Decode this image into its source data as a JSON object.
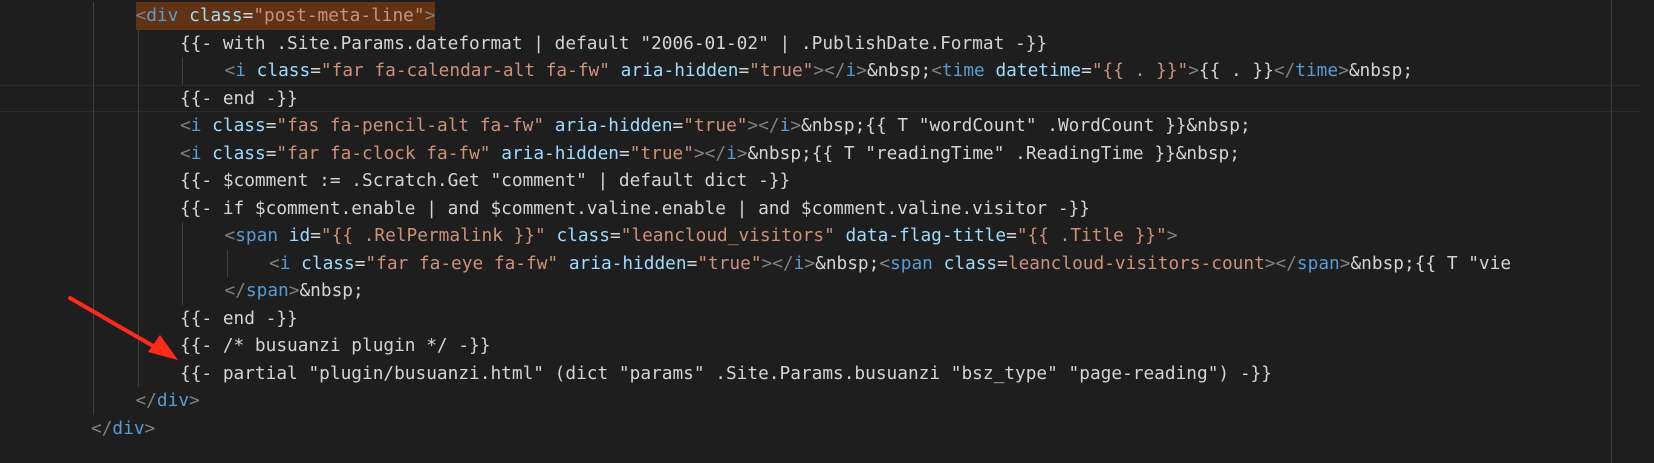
{
  "editor": {
    "lines": [
      {
        "indent": 3,
        "tokens": [
          [
            "br",
            "<"
          ],
          [
            "tag",
            "div"
          ],
          [
            "txt",
            " "
          ],
          [
            "attr",
            "class"
          ],
          [
            "txt",
            "="
          ],
          [
            "str",
            "\"post-meta-line\""
          ],
          [
            "br",
            ">"
          ]
        ],
        "highlight": true
      },
      {
        "indent": 4,
        "tokens": [
          [
            "txt",
            "{{- with .Site.Params.dateformat | default \"2006-01-02\" | .PublishDate.Format -}}"
          ]
        ]
      },
      {
        "indent": 5,
        "tokens": [
          [
            "br",
            "<"
          ],
          [
            "tag",
            "i"
          ],
          [
            "txt",
            " "
          ],
          [
            "attr",
            "class"
          ],
          [
            "txt",
            "="
          ],
          [
            "str",
            "\"far fa-calendar-alt fa-fw\""
          ],
          [
            "txt",
            " "
          ],
          [
            "attr",
            "aria-hidden"
          ],
          [
            "txt",
            "="
          ],
          [
            "str",
            "\"true\""
          ],
          [
            "br",
            "></"
          ],
          [
            "tag",
            "i"
          ],
          [
            "br",
            ">"
          ],
          [
            "txt",
            "&nbsp;"
          ],
          [
            "br",
            "<"
          ],
          [
            "tag",
            "time"
          ],
          [
            "txt",
            " "
          ],
          [
            "attr",
            "datetime"
          ],
          [
            "txt",
            "="
          ],
          [
            "str",
            "\"{{ . }}\""
          ],
          [
            "br",
            ">"
          ],
          [
            "txt",
            "{{ . }}"
          ],
          [
            "br",
            "</"
          ],
          [
            "tag",
            "time"
          ],
          [
            "br",
            ">"
          ],
          [
            "txt",
            "&nbsp;"
          ]
        ]
      },
      {
        "indent": 4,
        "tokens": [
          [
            "txt",
            "{{- end -}}"
          ]
        ],
        "current": true
      },
      {
        "indent": 4,
        "tokens": [
          [
            "br",
            "<"
          ],
          [
            "tag",
            "i"
          ],
          [
            "txt",
            " "
          ],
          [
            "attr",
            "class"
          ],
          [
            "txt",
            "="
          ],
          [
            "str",
            "\"fas fa-pencil-alt fa-fw\""
          ],
          [
            "txt",
            " "
          ],
          [
            "attr",
            "aria-hidden"
          ],
          [
            "txt",
            "="
          ],
          [
            "str",
            "\"true\""
          ],
          [
            "br",
            "></"
          ],
          [
            "tag",
            "i"
          ],
          [
            "br",
            ">"
          ],
          [
            "txt",
            "&nbsp;{{ T \"wordCount\" .WordCount }}&nbsp;"
          ]
        ]
      },
      {
        "indent": 4,
        "tokens": [
          [
            "br",
            "<"
          ],
          [
            "tag",
            "i"
          ],
          [
            "txt",
            " "
          ],
          [
            "attr",
            "class"
          ],
          [
            "txt",
            "="
          ],
          [
            "str",
            "\"far fa-clock fa-fw\""
          ],
          [
            "txt",
            " "
          ],
          [
            "attr",
            "aria-hidden"
          ],
          [
            "txt",
            "="
          ],
          [
            "str",
            "\"true\""
          ],
          [
            "br",
            "></"
          ],
          [
            "tag",
            "i"
          ],
          [
            "br",
            ">"
          ],
          [
            "txt",
            "&nbsp;{{ T \"readingTime\" .ReadingTime }}&nbsp;"
          ]
        ]
      },
      {
        "indent": 4,
        "tokens": [
          [
            "txt",
            "{{- $comment := .Scratch.Get \"comment\" | default dict -}}"
          ]
        ]
      },
      {
        "indent": 4,
        "tokens": [
          [
            "txt",
            "{{- if $comment.enable | and $comment.valine.enable | and $comment.valine.visitor -}}"
          ]
        ]
      },
      {
        "indent": 5,
        "tokens": [
          [
            "br",
            "<"
          ],
          [
            "tag",
            "span"
          ],
          [
            "txt",
            " "
          ],
          [
            "attr",
            "id"
          ],
          [
            "txt",
            "="
          ],
          [
            "str",
            "\"{{ .RelPermalink }}\""
          ],
          [
            "txt",
            " "
          ],
          [
            "attr",
            "class"
          ],
          [
            "txt",
            "="
          ],
          [
            "str",
            "\"leancloud_visitors\""
          ],
          [
            "txt",
            " "
          ],
          [
            "attr",
            "data-flag-title"
          ],
          [
            "txt",
            "="
          ],
          [
            "str",
            "\"{{ .Title }}\""
          ],
          [
            "br",
            ">"
          ]
        ]
      },
      {
        "indent": 6,
        "tokens": [
          [
            "br",
            "<"
          ],
          [
            "tag",
            "i"
          ],
          [
            "txt",
            " "
          ],
          [
            "attr",
            "class"
          ],
          [
            "txt",
            "="
          ],
          [
            "str",
            "\"far fa-eye fa-fw\""
          ],
          [
            "txt",
            " "
          ],
          [
            "attr",
            "aria-hidden"
          ],
          [
            "txt",
            "="
          ],
          [
            "str",
            "\"true\""
          ],
          [
            "br",
            "></"
          ],
          [
            "tag",
            "i"
          ],
          [
            "br",
            ">"
          ],
          [
            "txt",
            "&nbsp;"
          ],
          [
            "br",
            "<"
          ],
          [
            "tag",
            "span"
          ],
          [
            "txt",
            " "
          ],
          [
            "attr",
            "class"
          ],
          [
            "txt",
            "="
          ],
          [
            "str",
            "leancloud-visitors-count"
          ],
          [
            "br",
            "></"
          ],
          [
            "tag",
            "span"
          ],
          [
            "br",
            ">"
          ],
          [
            "txt",
            "&nbsp;{{ T \"vie"
          ]
        ]
      },
      {
        "indent": 5,
        "tokens": [
          [
            "br",
            "</"
          ],
          [
            "tag",
            "span"
          ],
          [
            "br",
            ">"
          ],
          [
            "txt",
            "&nbsp;"
          ]
        ]
      },
      {
        "indent": 4,
        "tokens": [
          [
            "txt",
            "{{- end -}}"
          ]
        ]
      },
      {
        "indent": 4,
        "tokens": [
          [
            "txt",
            "{{- /* busuanzi plugin */ -}}"
          ]
        ]
      },
      {
        "indent": 4,
        "tokens": [
          [
            "txt",
            "{{- partial \"plugin/busuanzi.html\" (dict \"params\" .Site.Params.busuanzi \"bsz_type\" \"page-reading\") -}}"
          ]
        ]
      },
      {
        "indent": 3,
        "tokens": [
          [
            "br",
            "</"
          ],
          [
            "tag",
            "div"
          ],
          [
            "br",
            ">"
          ]
        ]
      },
      {
        "indent": 2,
        "tokens": [
          [
            "br",
            "</"
          ],
          [
            "tag",
            "div"
          ],
          [
            "br",
            ">"
          ]
        ]
      }
    ]
  },
  "annotation": {
    "arrow_color": "#ff2a1a"
  },
  "colors": {
    "background": "#1e1e1e",
    "tag": "#569cd6",
    "attribute": "#9cdcfe",
    "string": "#ce9178",
    "text": "#d4d4d4",
    "bracket": "#808080"
  }
}
